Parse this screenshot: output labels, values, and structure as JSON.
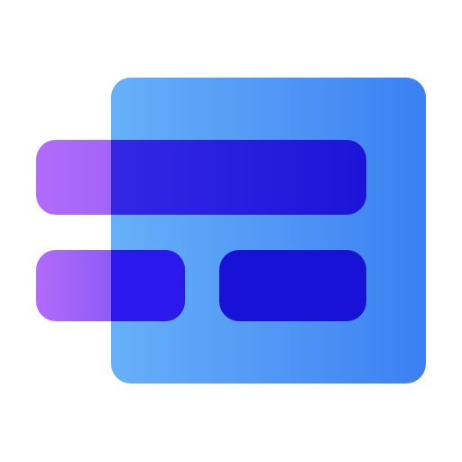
{
  "icon": {
    "name": "layout-blocks-icon",
    "colors": {
      "panel_gradient_start": "#67b0f9",
      "panel_gradient_end": "#3b80f3",
      "bar_gradient_start": "#b26bf9",
      "bar_gradient_end": "#6b4df5",
      "overlap_start": "#3a2de8",
      "overlap_end": "#1c14d8",
      "solid_block": "#1812d6"
    }
  }
}
